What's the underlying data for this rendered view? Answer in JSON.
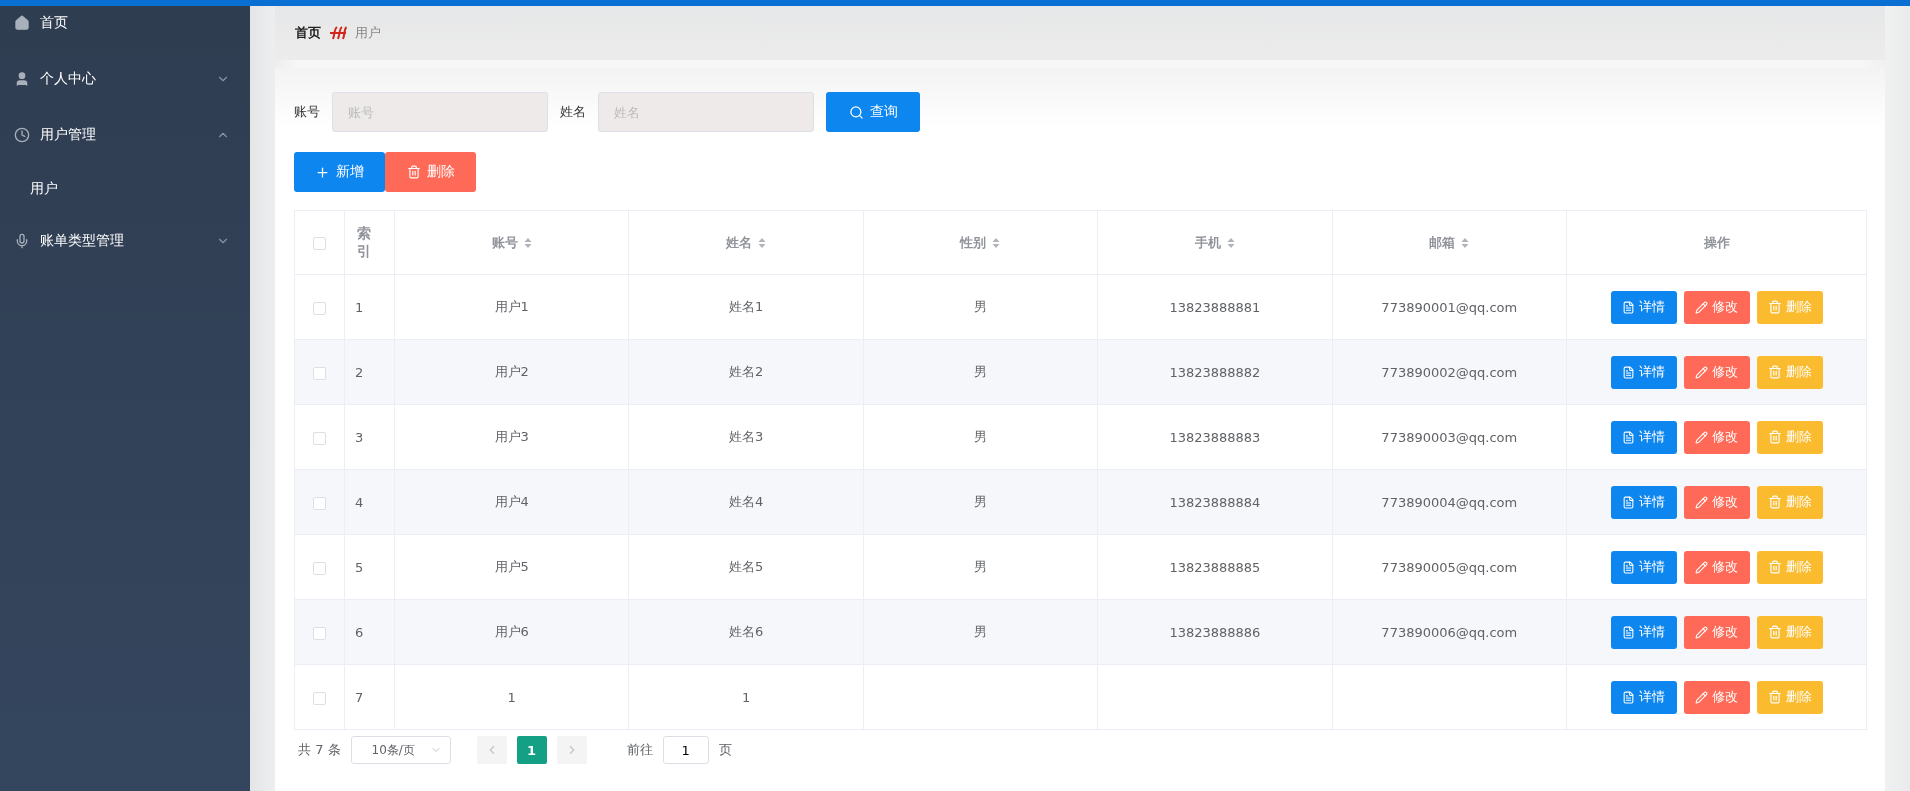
{
  "sidebar": {
    "items": [
      {
        "label": "首页",
        "kind": "link"
      },
      {
        "label": "个人中心",
        "kind": "menu",
        "expanded": false
      },
      {
        "label": "用户管理",
        "kind": "menu",
        "expanded": true,
        "children": [
          {
            "label": "用户"
          }
        ]
      },
      {
        "label": "账单类型管理",
        "kind": "menu",
        "expanded": false
      }
    ]
  },
  "breadcrumb": [
    "首页",
    "用户"
  ],
  "search": {
    "fields": [
      {
        "label": "账号",
        "placeholder": "账号"
      },
      {
        "label": "姓名",
        "placeholder": "姓名"
      }
    ],
    "button": "查询"
  },
  "actions": [
    {
      "label": "新增",
      "kind": "add"
    },
    {
      "label": "删除",
      "kind": "delete"
    }
  ],
  "table": {
    "all_checked": false,
    "columns": [
      "索引",
      "账号",
      "姓名",
      "性别",
      "手机",
      "邮箱",
      "操作"
    ],
    "rows": [
      {
        "cells": [
          "1",
          "用户1",
          "姓名1",
          "男",
          "13823888881",
          "773890001@qq.com"
        ],
        "checked": false,
        "buttons": [
          {
            "label": "详情",
            "kind": "detail"
          },
          {
            "label": "修改",
            "kind": "edit"
          },
          {
            "label": "删除",
            "kind": "delete"
          }
        ]
      },
      {
        "cells": [
          "2",
          "用户2",
          "姓名2",
          "男",
          "13823888882",
          "773890002@qq.com"
        ],
        "checked": false,
        "buttons": [
          {
            "label": "详情",
            "kind": "detail"
          },
          {
            "label": "修改",
            "kind": "edit"
          },
          {
            "label": "删除",
            "kind": "delete"
          }
        ]
      },
      {
        "cells": [
          "3",
          "用户3",
          "姓名3",
          "男",
          "13823888883",
          "773890003@qq.com"
        ],
        "checked": false,
        "buttons": [
          {
            "label": "详情",
            "kind": "detail"
          },
          {
            "label": "修改",
            "kind": "edit"
          },
          {
            "label": "删除",
            "kind": "delete"
          }
        ]
      },
      {
        "cells": [
          "4",
          "用户4",
          "姓名4",
          "男",
          "13823888884",
          "773890004@qq.com"
        ],
        "checked": false,
        "buttons": [
          {
            "label": "详情",
            "kind": "detail"
          },
          {
            "label": "修改",
            "kind": "edit"
          },
          {
            "label": "删除",
            "kind": "delete"
          }
        ]
      },
      {
        "cells": [
          "5",
          "用户5",
          "姓名5",
          "男",
          "13823888885",
          "773890005@qq.com"
        ],
        "checked": false,
        "buttons": [
          {
            "label": "详情",
            "kind": "detail"
          },
          {
            "label": "修改",
            "kind": "edit"
          },
          {
            "label": "删除",
            "kind": "delete"
          }
        ]
      },
      {
        "cells": [
          "6",
          "用户6",
          "姓名6",
          "男",
          "13823888886",
          "773890006@qq.com"
        ],
        "checked": false,
        "buttons": [
          {
            "label": "详情",
            "kind": "detail"
          },
          {
            "label": "修改",
            "kind": "edit"
          },
          {
            "label": "删除",
            "kind": "delete"
          }
        ]
      },
      {
        "cells": [
          "7",
          "1",
          "1",
          "",
          "",
          ""
        ],
        "checked": false,
        "buttons": [
          {
            "label": "详情",
            "kind": "detail"
          },
          {
            "label": "修改",
            "kind": "edit"
          },
          {
            "label": "删除",
            "kind": "delete"
          }
        ]
      }
    ]
  },
  "pagination": {
    "total": "共 7 条",
    "page_size": "10条/页",
    "pages": [
      {
        "label": "1",
        "selected": true
      }
    ],
    "goto_label": "前往",
    "goto_value": "1",
    "page_unit": "页"
  }
}
